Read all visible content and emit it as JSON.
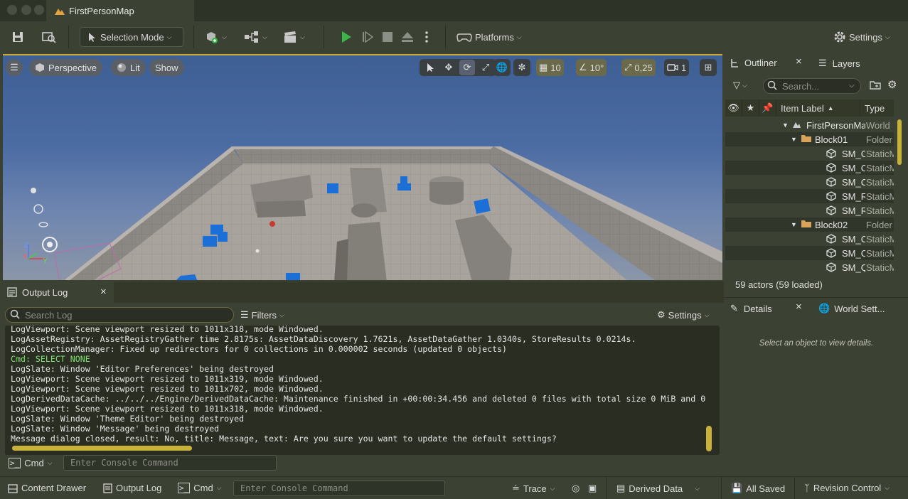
{
  "window": {
    "document_tab": "FirstPersonMap"
  },
  "toolbar": {
    "selection_mode": "Selection Mode",
    "platforms": "Platforms",
    "settings": "Settings"
  },
  "viewport": {
    "perspective": "Perspective",
    "lit": "Lit",
    "show": "Show",
    "grid_snap": "10",
    "rotation_snap": "10°",
    "scale_snap": "0,25",
    "camera_speed": "1"
  },
  "output_log": {
    "tab_label": "Output Log",
    "search_placeholder": "Search Log",
    "filters": "Filters",
    "settings": "Settings",
    "lines": [
      {
        "text": "LogViewport: Scene viewport resized to 1011x318, mode Windowed.",
        "kind": "log"
      },
      {
        "text": "LogAssetRegistry: AssetRegistryGather time 2.8175s: AssetDataDiscovery 1.7621s, AssetDataGather 1.0340s, StoreResults 0.0214s.",
        "kind": "log"
      },
      {
        "text": "LogCollectionManager: Fixed up redirectors for 0 collections in 0.000002 seconds (updated 0 objects)",
        "kind": "log"
      },
      {
        "text": "Cmd: SELECT NONE",
        "kind": "cmd"
      },
      {
        "text": "LogSlate: Window 'Editor Preferences' being destroyed",
        "kind": "log"
      },
      {
        "text": "LogViewport: Scene viewport resized to 1011x319, mode Windowed.",
        "kind": "log"
      },
      {
        "text": "LogViewport: Scene viewport resized to 1011x702, mode Windowed.",
        "kind": "log"
      },
      {
        "text": "LogDerivedDataCache: ../../../Engine/DerivedDataCache: Maintenance finished in +00:00:34.456 and deleted 0 files with total size 0 MiB and 0",
        "kind": "log"
      },
      {
        "text": "LogViewport: Scene viewport resized to 1011x318, mode Windowed.",
        "kind": "log"
      },
      {
        "text": "LogSlate: Window 'Theme Editor' being destroyed",
        "kind": "log"
      },
      {
        "text": "LogSlate: Window 'Message' being destroyed",
        "kind": "log"
      },
      {
        "text": "Message dialog closed, result: No, title: Message, text: Are you sure you want to update the default settings?",
        "kind": "log"
      }
    ],
    "cmd_label": "Cmd",
    "console_placeholder": "Enter Console Command"
  },
  "outliner": {
    "tab_label": "Outliner",
    "layers_tab": "Layers",
    "search_placeholder": "Search...",
    "col_label": "Item Label",
    "col_type": "Type",
    "rows": [
      {
        "label": "FirstPersonMap",
        "type": "World",
        "icon": "world-icon",
        "indent": 1,
        "expander": true
      },
      {
        "label": "Block01",
        "type": "Folder",
        "icon": "folder-icon",
        "indent": 2,
        "expander": true
      },
      {
        "label": "SM_Cube",
        "type": "StaticMesh",
        "icon": "cube-icon",
        "indent": 3,
        "expander": false
      },
      {
        "label": "SM_Cube",
        "type": "StaticMesh",
        "icon": "cube-icon",
        "indent": 3,
        "expander": false
      },
      {
        "label": "SM_Cube",
        "type": "StaticMesh",
        "icon": "cube-icon",
        "indent": 3,
        "expander": false
      },
      {
        "label": "SM_Ramp",
        "type": "StaticMesh",
        "icon": "cube-icon",
        "indent": 3,
        "expander": false
      },
      {
        "label": "SM_Ramp",
        "type": "StaticMesh",
        "icon": "cube-icon",
        "indent": 3,
        "expander": false
      },
      {
        "label": "Block02",
        "type": "Folder",
        "icon": "folder-icon",
        "indent": 2,
        "expander": true
      },
      {
        "label": "SM_Cube",
        "type": "StaticMesh",
        "icon": "cube-icon",
        "indent": 3,
        "expander": false
      },
      {
        "label": "SM_Cube",
        "type": "StaticMesh",
        "icon": "cube-icon",
        "indent": 3,
        "expander": false
      },
      {
        "label": "SM_Quad",
        "type": "StaticMesh",
        "icon": "cube-icon",
        "indent": 3,
        "expander": false
      }
    ],
    "actor_count": "59 actors (59 loaded)"
  },
  "details": {
    "tab_label": "Details",
    "world_settings_tab": "World Sett...",
    "empty_text": "Select an object to view details."
  },
  "statusbar": {
    "content_drawer": "Content Drawer",
    "output_log": "Output Log",
    "cmd": "Cmd",
    "console_placeholder": "Enter Console Command",
    "trace": "Trace",
    "derived_data": "Derived Data",
    "all_saved": "All Saved",
    "revision_control": "Revision Control"
  },
  "colors": {
    "play_green": "#39b54a",
    "accent_yellow": "#c9b23a",
    "panel_bg": "#3c4233",
    "log_bg": "#2a2e22",
    "cmd_text": "#7ee36e"
  }
}
